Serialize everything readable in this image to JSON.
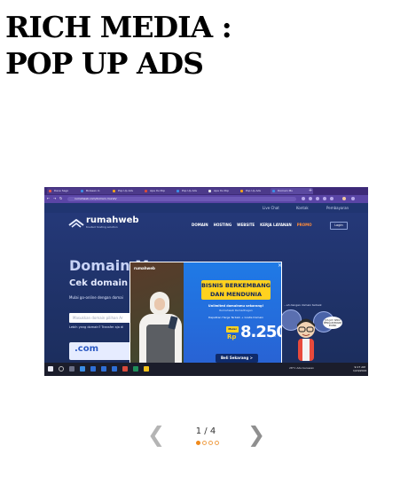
{
  "heading": {
    "line1": "RICH MEDIA :",
    "line2": "POP UP ADS"
  },
  "screenshot": {
    "browser": {
      "tabs": [
        "Dave Sago",
        "Bolasan lo",
        "Pop Up Ads",
        "Apa itu Pop",
        "Pop Up Ads",
        "Apa itu Pop",
        "Pop Up Ads",
        "Domain Mu"
      ],
      "active_tab": 7,
      "url": "rumahweb.com/domain-murah/"
    },
    "site": {
      "top_links": [
        "Live Chat",
        "Kontak",
        "Pembayaran"
      ],
      "brand": "rumahweb",
      "tagline": "trusted hosting solution",
      "menu": [
        "DOMAIN",
        "HOSTING",
        "WEBSITE",
        "KERJA LAYANAN"
      ],
      "promo": "PROMO",
      "login": "Login",
      "hero_title": "Domain M",
      "hero_subtitle": "Cek domain mu",
      "hero_text": "Mulai go-online dengan domai",
      "search_placeholder": "Masukkan domain pilihan Ar",
      "search_note": "Lebih yang domain? Transfer aja di",
      "right_note": "...ah dengan domain terbaik",
      "tld": ".com"
    },
    "popup": {
      "brand": "rumahweb",
      "headline1": "BISNIS BERKEMBANG",
      "headline2": "DAN MENDUNIA",
      "sub1": "Unlimited domainmu sekarang!",
      "sub2": "Rumahweb Ramadhagan",
      "sub3": "Dapatkan Harga Terbaik + Gratis Domain",
      "from_label": "Mulai dari",
      "currency": "Rp",
      "price": "8.250",
      "price_unit": "/bln",
      "cta": "Beli Sekarang >",
      "close": "×"
    },
    "mascot_bubble": "JUS JAY! SERU DENGAN BRAND PURBA",
    "taskbar": {
      "weather": "28°C Ada berawan",
      "time": "9:17 AM",
      "date": "1/24/2022"
    }
  },
  "pager": {
    "counter": "1 / 4",
    "prev_icon": "chevron-left-icon",
    "next_icon": "chevron-right-icon",
    "prev_glyph": "❮",
    "next_glyph": "❯",
    "total": 4,
    "current": 1
  },
  "colors": {
    "accent": "#f08a1c",
    "site_bg": "#1f3268",
    "popup_yellow": "#ffd21f"
  }
}
